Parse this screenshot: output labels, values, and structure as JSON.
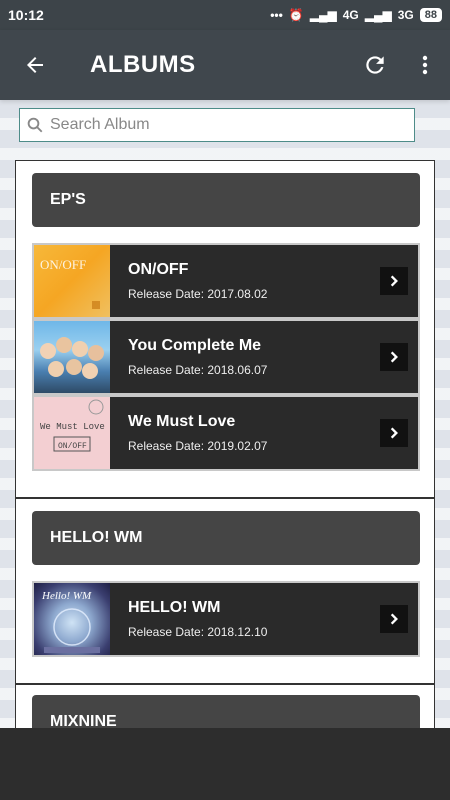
{
  "status": {
    "time": "10:12",
    "dots": "•••",
    "net1": "4G",
    "net2": "3G",
    "battery": "88"
  },
  "header": {
    "title": "ALBUMS"
  },
  "search": {
    "placeholder": "Search Album"
  },
  "sections": [
    {
      "title": "EP'S",
      "albums": [
        {
          "title": "ON/OFF",
          "release": "Release Date: 2017.08.02",
          "cover_text": "ON/OFF"
        },
        {
          "title": "You Complete Me",
          "release": "Release Date: 2018.06.07",
          "cover_text": ""
        },
        {
          "title": "We Must Love",
          "release": "Release Date: 2019.02.07",
          "cover_text": "We Must Love"
        }
      ]
    },
    {
      "title": "HELLO! WM",
      "albums": [
        {
          "title": "HELLO! WM",
          "release": "Release Date: 2018.12.10",
          "cover_text": "Hello! WM"
        }
      ]
    },
    {
      "title": "MIXNINE",
      "albums": []
    }
  ],
  "colors": {
    "app_bar": "#40474d",
    "status_bar": "#3d4449",
    "section_header": "#454545",
    "album_row": "#2a2a2a",
    "search_border": "#4e8c89"
  }
}
